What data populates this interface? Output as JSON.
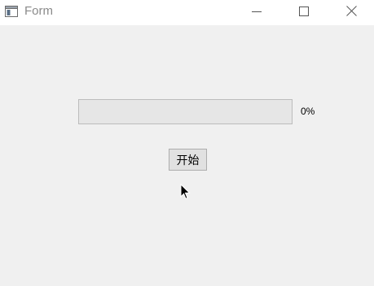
{
  "window": {
    "title": "Form",
    "icons": {
      "app": "window-icon",
      "minimize": "minimize-icon",
      "maximize": "maximize-icon",
      "close": "close-icon"
    }
  },
  "main": {
    "progress": {
      "value_percent": 0,
      "label": "0%"
    },
    "start_button_label": "开始",
    "cursor_icon": "mouse-pointer-icon"
  },
  "colors": {
    "window_bg": "#f0f0f0",
    "titlebar_bg": "#ffffff",
    "title_text": "#8a8a8a",
    "progress_fill": "#06b025",
    "progress_track": "#e6e6e6",
    "button_bg": "#e1e1e1"
  }
}
